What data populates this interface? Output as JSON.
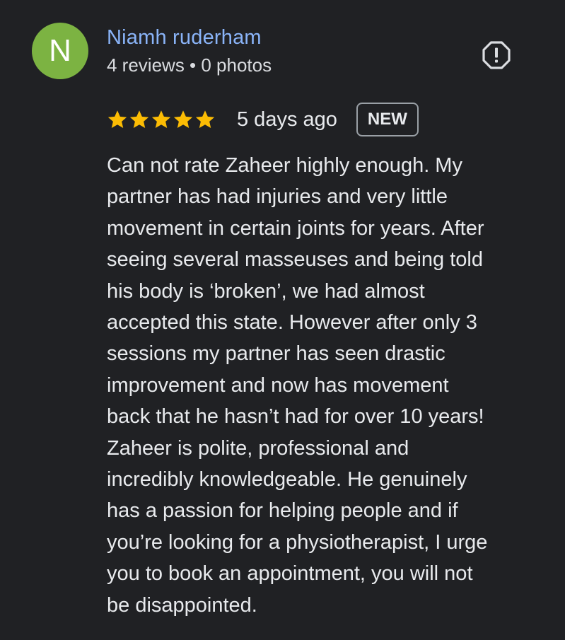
{
  "colors": {
    "background": "#202124",
    "avatar_bg": "#7cb342",
    "name_link": "#8ab4f8",
    "star": "#fbbc04",
    "text": "#e8eaed",
    "muted_text": "#dadce0",
    "badge_border": "#9aa0a6"
  },
  "reviewer": {
    "initial": "N",
    "name": "Niamh ruderham",
    "stats": "4 reviews • 0 photos"
  },
  "report_icon": "report-flag-icon",
  "rating": {
    "value": 5,
    "max": 5,
    "icon": "star-icon"
  },
  "date": "5 days ago",
  "badge": "NEW",
  "review": {
    "lines": [
      "Can not rate Zaheer highly enough. My",
      "partner has had injuries and very little",
      "movement in certain joints for years. After",
      "seeing several masseuses and being told",
      "his body is ‘broken’, we had almost",
      "accepted this state. However after only 3",
      "sessions my partner has seen drastic",
      "improvement and now has movement",
      "back that he hasn’t had for over 10 years!",
      "Zaheer is polite, professional and",
      "incredibly knowledgeable. He genuinely",
      "has a passion for helping people and if",
      "you’re looking for a physiotherapist, I urge",
      "you to book an appointment, you will not",
      "be disappointed."
    ]
  }
}
